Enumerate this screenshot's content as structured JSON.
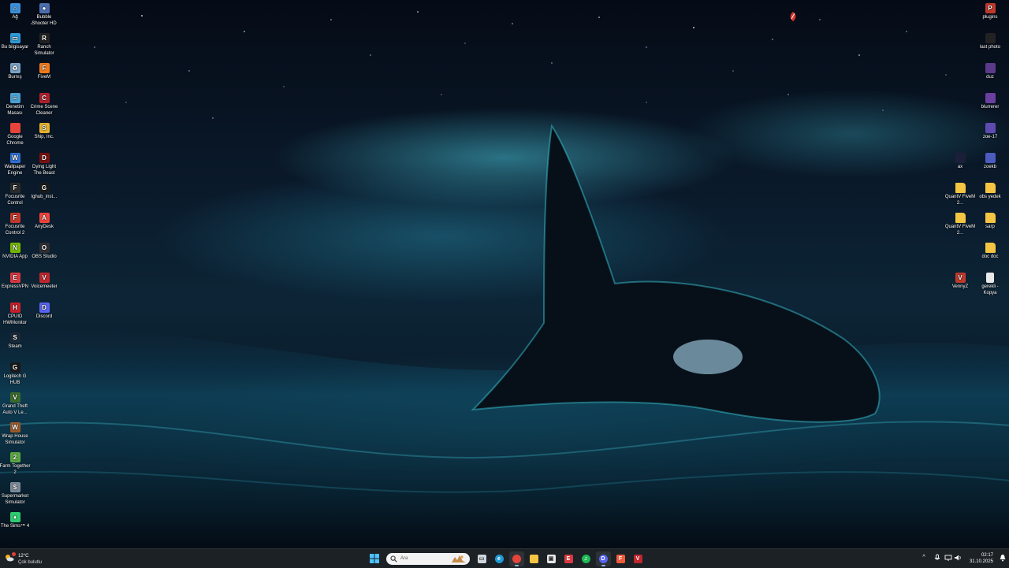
{
  "desktop": {
    "left_col1": [
      {
        "label": "Ağ",
        "icon": "network-icon",
        "color": "#3b8fd6"
      },
      {
        "label": "Bu bilgisayar",
        "icon": "computer-icon",
        "color": "#2f9ad8"
      },
      {
        "label": "Burnış",
        "icon": "recycle-bin-icon",
        "color": "#7aa3c4"
      },
      {
        "label": "Denetim Masası",
        "icon": "control-panel-icon",
        "color": "#4aa0d0"
      },
      {
        "label": "Google Chrome",
        "icon": "chrome-icon",
        "color": "#e5443a"
      },
      {
        "label": "Wallpaper Engine",
        "icon": "wallpaper-engine-icon",
        "color": "#2f6fd3"
      },
      {
        "label": "Focusrite Control",
        "icon": "focusrite-icon",
        "color": "#2b2b2b"
      },
      {
        "label": "Focusrite Control 2",
        "icon": "focusrite-icon",
        "color": "#c0392b"
      },
      {
        "label": "NVIDIA App",
        "icon": "nvidia-icon",
        "color": "#76b900"
      },
      {
        "label": "ExpressVPN",
        "icon": "expressvpn-icon",
        "color": "#da3940"
      },
      {
        "label": "CPUID HWMonitor",
        "icon": "hwmonitor-icon",
        "color": "#c8202b"
      },
      {
        "label": "Steam",
        "icon": "steam-icon",
        "color": "#1b2838"
      },
      {
        "label": "Logitech G HUB",
        "icon": "logitech-icon",
        "color": "#1a1a1a"
      },
      {
        "label": "Grand Theft Auto V Le...",
        "icon": "gta-icon",
        "color": "#3b6b2c"
      },
      {
        "label": "Wrap House Simulator",
        "icon": "wrap-house-icon",
        "color": "#9b5a2a"
      },
      {
        "label": "Farm Together 2",
        "icon": "farm-icon",
        "color": "#5aa640"
      },
      {
        "label": "Supermarket Simulator",
        "icon": "supermarket-icon",
        "color": "#7d8a99"
      },
      {
        "label": "The Sims™ 4",
        "icon": "sims-icon",
        "color": "#2ecc71"
      }
    ],
    "left_col2": [
      {
        "label": "Bubble Shooter HD",
        "icon": "bubble-shooter-icon",
        "color": "#4c6fb0"
      },
      {
        "label": "Ranch Simulator",
        "icon": "ranch-icon",
        "color": "#222222"
      },
      {
        "label": "FiveM",
        "icon": "fivem-icon",
        "color": "#f07b1c"
      },
      {
        "label": "Crime Scene Cleaner",
        "icon": "crime-scene-icon",
        "color": "#b0202c"
      },
      {
        "label": "Ship, Inc.",
        "icon": "ship-inc-icon",
        "color": "#e5b22d"
      },
      {
        "label": "Dying Light The Beast",
        "icon": "dying-light-icon",
        "color": "#7a1010"
      },
      {
        "label": "lghub_inst...",
        "icon": "logitech-icon",
        "color": "#1a1a1a"
      },
      {
        "label": "AnyDesk",
        "icon": "anydesk-icon",
        "color": "#ef443b"
      },
      {
        "label": "OBS Studio",
        "icon": "obs-icon",
        "color": "#302e31"
      },
      {
        "label": "Voicemeeter",
        "icon": "voicemeeter-icon",
        "color": "#c0262d"
      },
      {
        "label": "Discord",
        "icon": "discord-icon",
        "color": "#5865f2"
      }
    ],
    "right_col1": [
      {
        "label": "ax",
        "icon": "image-icon",
        "color": "#1b1f3a"
      },
      {
        "label": "QuantV FiveM 2...",
        "icon": "folder-icon",
        "color": "#f4c542"
      },
      {
        "label": "QuantV FiveM 2...",
        "icon": "folder-icon",
        "color": "#f4c542"
      },
      {
        "label": "VennyZ",
        "icon": "vennyz-icon",
        "color": "#c0392b"
      }
    ],
    "right_col2": [
      {
        "label": "plugins",
        "icon": "plugins-icon",
        "color": "#c0392b"
      },
      {
        "label": "last photo",
        "icon": "image-icon",
        "color": "#222222"
      },
      {
        "label": "duz",
        "icon": "image-icon",
        "color": "#5b3a8a"
      },
      {
        "label": "blurrerer",
        "icon": "image-icon",
        "color": "#6a3fa0"
      },
      {
        "label": "zoe-17",
        "icon": "image-icon",
        "color": "#5f4bb0"
      },
      {
        "label": "zoekb",
        "icon": "image-icon",
        "color": "#4b5bc0"
      },
      {
        "label": "obs yedek",
        "icon": "folder-icon",
        "color": "#f4c542"
      },
      {
        "label": "sarp",
        "icon": "folder-icon",
        "color": "#f4c542"
      },
      {
        "label": "doc doc",
        "icon": "folder-icon",
        "color": "#f4c542"
      },
      {
        "label": "gerekli - Kopya",
        "icon": "document-icon",
        "color": "#e8e8e8"
      }
    ]
  },
  "taskbar": {
    "weather": {
      "temp": "12°C",
      "condition": "Çok bulutlu",
      "icon": "weather-sun-cloud-icon"
    },
    "search_placeholder": "Ara",
    "apps": [
      {
        "name": "task-view",
        "icon": "task-view-icon",
        "color": "#cfd6dc",
        "active": false
      },
      {
        "name": "edge",
        "icon": "edge-icon",
        "color": "#1f9bd7",
        "active": false
      },
      {
        "name": "chrome",
        "icon": "chrome-icon",
        "color": "#e5443a",
        "active": true
      },
      {
        "name": "file-explorer",
        "icon": "folder-icon",
        "color": "#f4c542",
        "active": false
      },
      {
        "name": "microsoft-store",
        "icon": "store-icon",
        "color": "#e8e8e8",
        "active": false
      },
      {
        "name": "expressvpn",
        "icon": "expressvpn-icon",
        "color": "#da3940",
        "active": false
      },
      {
        "name": "spotify",
        "icon": "spotify-icon",
        "color": "#1db954",
        "active": false
      },
      {
        "name": "discord",
        "icon": "discord-icon",
        "color": "#5865f2",
        "active": true
      },
      {
        "name": "fivem",
        "icon": "fivem-icon",
        "color": "#ef5b3b",
        "active": false
      },
      {
        "name": "voicemeeter",
        "icon": "voicemeeter-icon",
        "color": "#c0262d",
        "active": false
      }
    ],
    "clock": {
      "time": "02:17",
      "date": "31.10.2025"
    }
  }
}
